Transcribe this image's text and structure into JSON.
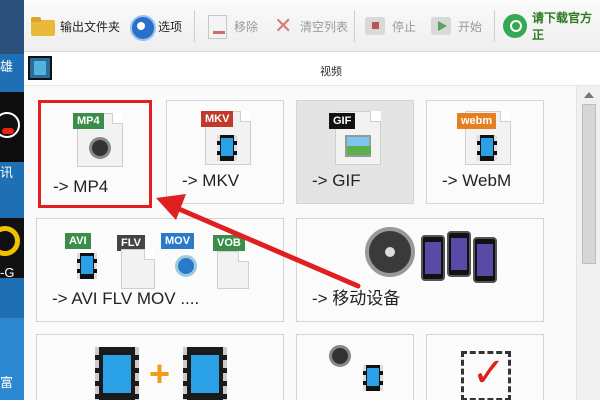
{
  "toolbar": {
    "output_folder": "输出文件夹",
    "options": "选项",
    "remove": "移除",
    "clear_list": "清空列表",
    "stop": "停止",
    "start": "开始",
    "download": "请下载官方正"
  },
  "category": {
    "title": "视频"
  },
  "tiles": [
    {
      "label": "-> MP4",
      "tag": "MP4",
      "tag_color": "#3c8d4a"
    },
    {
      "label": "-> MKV",
      "tag": "MKV",
      "tag_color": "#c0392b"
    },
    {
      "label": "-> GIF",
      "tag": "GIF",
      "tag_color": "#111111"
    },
    {
      "label": "-> WebM",
      "tag": "webm",
      "tag_color": "#e67e22"
    },
    {
      "label": "-> AVI FLV MOV ....",
      "tags": [
        "AVI",
        "FLV",
        "MOV",
        "VOB"
      ]
    },
    {
      "label": "-> 移动设备"
    }
  ],
  "desktop": {
    "text1": "雄",
    "text2": "讯",
    "text3": "-G",
    "text4": "富"
  },
  "highlight_color": "#e02020"
}
